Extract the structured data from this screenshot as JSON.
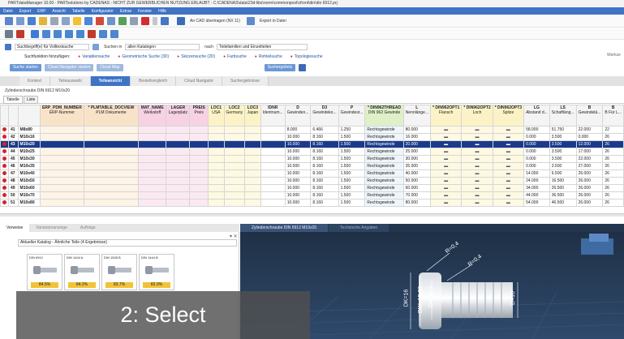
{
  "window": {
    "title": "PARTdataManager 10.00 - PARTsolutions by CADENAS - NICHT ZUR GEWERBLICHEN NUTZUNG ERLAUBT - C:\\CADENAS\\data\\23d-libs\\norm\\commonpool\\cfront\\din\\din 6912.prj"
  },
  "menu": [
    "Datei",
    "Export",
    "ERP",
    "Ansicht",
    "Tabelle",
    "Konfigurator",
    "Extras",
    "Fenster",
    "Hilfe"
  ],
  "toolbar": {
    "cad_export_label": "An CAD übertragen (NX 11)",
    "export_label": "Export in Datei"
  },
  "search": {
    "placeholder": "Suchbegriff(e) für Volltextsuche",
    "in_label": "Suchen in",
    "catalog_value": "allen Katalogen",
    "after_label": "nach",
    "after_value": "Teilefamilien und Einzelteilen"
  },
  "search_functions": {
    "label": "Suchfunktion hinzufügen:",
    "items": [
      "Variablensuche",
      "Geometrische Suche (3D)",
      "Skizzensuche (2D)",
      "Farbsuche",
      "Rohteilsuche",
      "Topologiesuche"
    ]
  },
  "actions": {
    "start_search": "Suche starten",
    "cloud_nav": "Cloud Navigator starten",
    "cloud_map": "Cloud Map",
    "search_result": "Suchergebnis"
  },
  "right_edge_label": "Werkze",
  "main_tabs": [
    "Kontext",
    "Teileauswahl",
    "Teileansicht",
    "Bestellvergleich",
    "Cloud Navigator",
    "Suchergebnisse"
  ],
  "main_tabs_active": 2,
  "breadcrumb": "Zylinderschraube DIN 6912 M10x20",
  "sub_tabs": [
    "Tabelle",
    "Liste"
  ],
  "table": {
    "columns": [
      {
        "h1": "",
        "h2": ""
      },
      {
        "h1": "",
        "h2": ""
      },
      {
        "h1": "",
        "h2": ""
      },
      {
        "h1": "ERP_PDM_NUMBER",
        "h2": "ERP-Nummer"
      },
      {
        "h1": "* PLMTABLE_DOCVIEW",
        "h2": "PLM Dokumente"
      },
      {
        "h1": "MAT_NAME",
        "h2": "Werkstoff"
      },
      {
        "h1": "LAGER",
        "h2": "Lagerplatz"
      },
      {
        "h1": "PREIS",
        "h2": "Preis"
      },
      {
        "h1": "LOC1",
        "h2": "USA"
      },
      {
        "h1": "LOC2",
        "h2": "Germany"
      },
      {
        "h1": "LOC3",
        "h2": "Japan"
      },
      {
        "h1": "IDNR",
        "h2": "Identnum..."
      },
      {
        "h1": "D",
        "h2": "Gewinden..."
      },
      {
        "h1": "D3",
        "h2": "Gewindeko..."
      },
      {
        "h1": "P",
        "h2": "Gewindest..."
      },
      {
        "h1": "* DIN962THREAD",
        "h2": "DIN 962 Gewinde"
      },
      {
        "h1": "L",
        "h2": "Nennlänge..."
      },
      {
        "h1": "* DIN962OPT1",
        "h2": "Flansch"
      },
      {
        "h1": "* DIN962OPT2",
        "h2": "Loch"
      },
      {
        "h1": "* DIN962OPT3",
        "h2": "Spitze"
      },
      {
        "h1": "LG",
        "h2": "Abstand d..."
      },
      {
        "h1": "LS",
        "h2": "Schaftläng..."
      },
      {
        "h1": "B",
        "h2": "Gewindelä..."
      },
      {
        "h1": "B",
        "h2": "B Für L..."
      }
    ],
    "rows": [
      {
        "no": "41",
        "id": "M8x80",
        "d": "8.000",
        "d3": "6.466",
        "p": "1.250",
        "thread": "Rechtsgewinde",
        "l": "80.000",
        "lg": "58.000",
        "ls": "51.750",
        "b": "22.000",
        "b2": "22"
      },
      {
        "no": "42",
        "id": "M10x16",
        "d": "10.000",
        "d3": "8.160",
        "p": "1.500",
        "thread": "Rechtsgewinde",
        "l": "16.000",
        "lg": "0.000",
        "ls": "3.500",
        "b": "0.000",
        "b2": "26"
      },
      {
        "no": "43",
        "id": "M10x20",
        "d": "10.000",
        "d3": "8.160",
        "p": "1.500",
        "thread": "Rechtsgewinde",
        "l": "20.000",
        "lg": "0.000",
        "ls": "3.500",
        "b": "12.000",
        "b2": "26"
      },
      {
        "no": "44",
        "id": "M10x25",
        "d": "10.000",
        "d3": "8.160",
        "p": "1.500",
        "thread": "Rechtsgewinde",
        "l": "25.000",
        "lg": "0.000",
        "ls": "3.500",
        "b": "17.000",
        "b2": "26"
      },
      {
        "no": "45",
        "id": "M10x30",
        "d": "10.000",
        "d3": "8.160",
        "p": "1.500",
        "thread": "Rechtsgewinde",
        "l": "30.000",
        "lg": "0.000",
        "ls": "3.500",
        "b": "22.000",
        "b2": "26"
      },
      {
        "no": "46",
        "id": "M10x35",
        "d": "10.000",
        "d3": "8.160",
        "p": "1.500",
        "thread": "Rechtsgewinde",
        "l": "35.000",
        "lg": "0.000",
        "ls": "3.500",
        "b": "27.000",
        "b2": "26"
      },
      {
        "no": "47",
        "id": "M10x40",
        "d": "10.000",
        "d3": "8.160",
        "p": "1.500",
        "thread": "Rechtsgewinde",
        "l": "40.000",
        "lg": "14.000",
        "ls": "6.500",
        "b": "26.000",
        "b2": "26"
      },
      {
        "no": "48",
        "id": "M10x50",
        "d": "10.000",
        "d3": "8.160",
        "p": "1.500",
        "thread": "Rechtsgewinde",
        "l": "50.000",
        "lg": "24.000",
        "ls": "16.500",
        "b": "26.000",
        "b2": "26"
      },
      {
        "no": "49",
        "id": "M10x60",
        "d": "10.000",
        "d3": "8.160",
        "p": "1.500",
        "thread": "Rechtsgewinde",
        "l": "60.000",
        "lg": "34.000",
        "ls": "26.500",
        "b": "26.000",
        "b2": "26"
      },
      {
        "no": "50",
        "id": "M10x70",
        "d": "10.000",
        "d3": "8.160",
        "p": "1.500",
        "thread": "Rechtsgewinde",
        "l": "70.000",
        "lg": "44.000",
        "ls": "36.500",
        "b": "26.000",
        "b2": "26"
      },
      {
        "no": "51",
        "id": "M10x80",
        "d": "10.000",
        "d3": "8.160",
        "p": "1.500",
        "thread": "Rechtsgewinde",
        "l": "80.000",
        "lg": "54.000",
        "ls": "46.500",
        "b": "26.000",
        "b2": "26"
      }
    ],
    "selected_row": 2
  },
  "lower_left": {
    "tabs": [
      "Verweise",
      "Variantenanzeige",
      "Aufträge"
    ],
    "catalog_select": "Aktueller Katalog - Ähnliche Teile (4 Ergebnisse)",
    "similar_parts": [
      {
        "name": "DIN 6912",
        "pct": "84.5%"
      },
      {
        "name": "DIN 1444 A",
        "pct": "84.2%"
      },
      {
        "name": "DIN 1528 B",
        "pct": "83.7%"
      },
      {
        "name": "DIN 1444 B",
        "pct": "82.0%"
      }
    ]
  },
  "viewer": {
    "tabs": [
      "Zylinderschraube DIN 6912 M10x20",
      "Technische Angaben"
    ],
    "dims": [
      "R=0,4",
      "R=0,4",
      "DK=16",
      "DW=15,03",
      "DA=11,2",
      "D=10"
    ]
  },
  "caption": "2: Select",
  "colors": {
    "menu_bar": "#3f73c4",
    "selected_row": "#1a3a8c",
    "viewer_bg": "#1e2e43",
    "caption_bg": "#505050",
    "similarity_bar": "#f2c237"
  }
}
